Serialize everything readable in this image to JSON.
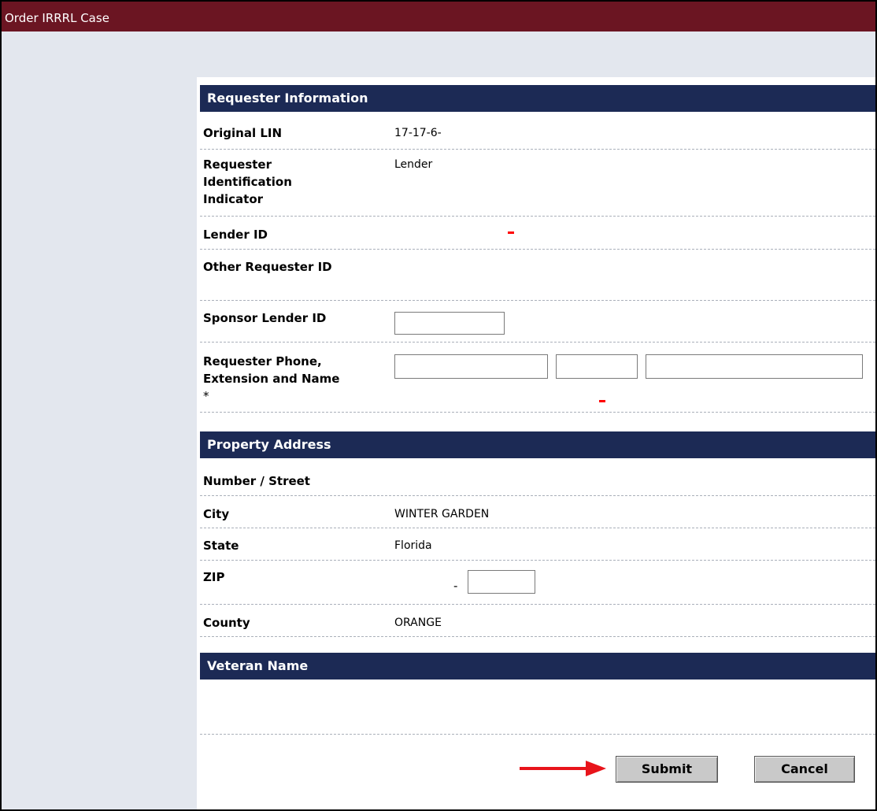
{
  "window": {
    "title": "Order IRRRL Case"
  },
  "requester_section": {
    "header": "Requester Information",
    "original_lin": {
      "label": "Original LIN",
      "value": "17-17-6-"
    },
    "requester_indicator": {
      "label": "Requester Identification Indicator",
      "value": "Lender"
    },
    "lender_id": {
      "label": "Lender ID",
      "value": ""
    },
    "other_requester_id": {
      "label": "Other Requester ID",
      "value": ""
    },
    "sponsor_lender_id": {
      "label": "Sponsor Lender ID",
      "input_value": ""
    },
    "requester_phone": {
      "label": "Requester Phone, Extension and Name",
      "required_marker": "*",
      "phone_value": "",
      "extension_value": "",
      "name_value": ""
    }
  },
  "property_section": {
    "header": "Property Address",
    "number_street": {
      "label": "Number / Street",
      "value": ""
    },
    "city": {
      "label": "City",
      "value": "WINTER GARDEN"
    },
    "state": {
      "label": "State",
      "value": "Florida"
    },
    "zip": {
      "label": "ZIP",
      "separator": "-",
      "zip4_value": ""
    },
    "county": {
      "label": "County",
      "value": "ORANGE"
    }
  },
  "veteran_section": {
    "header": "Veteran Name"
  },
  "actions": {
    "submit_label": "Submit",
    "cancel_label": "Cancel"
  },
  "colors": {
    "titlebar": "#6b1522",
    "section_header": "#1c2a55",
    "background": "#e3e7ee",
    "error_marker": "#ff0000",
    "annotation_arrow": "#e8141b"
  }
}
